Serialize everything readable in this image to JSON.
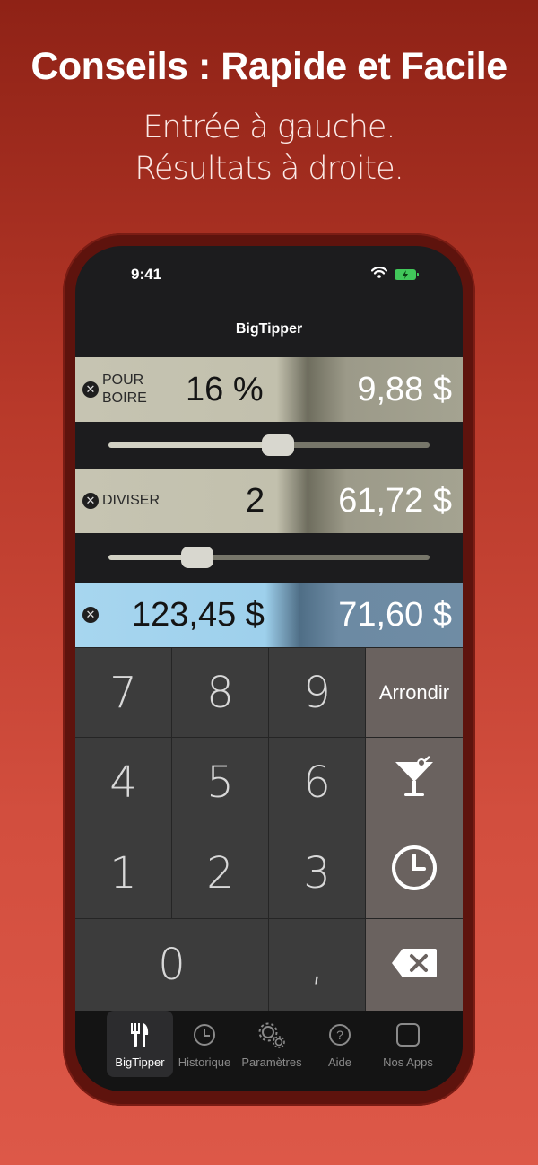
{
  "promo": {
    "headline": "Conseils : Rapide et Facile",
    "subline1": "Entrée à gauche.",
    "subline2": "Résultats à droite."
  },
  "status_bar": {
    "time": "9:41"
  },
  "nav": {
    "title": "BigTipper"
  },
  "tip_row": {
    "label_line1": "POUR",
    "label_line2": "BOIRE",
    "input_value": "16 %",
    "result_value": "9,88 $",
    "slider_value_fraction": 0.53
  },
  "split_row": {
    "label": "DIVISER",
    "input_value": "2",
    "result_value": "61,72 $",
    "slider_value_fraction": 0.28
  },
  "total_row": {
    "input_value": "123,45 $",
    "result_value": "71,60 $"
  },
  "keypad": {
    "keys": {
      "k7": "7",
      "k8": "8",
      "k9": "9",
      "k4": "4",
      "k5": "5",
      "k6": "6",
      "k1": "1",
      "k2": "2",
      "k3": "3",
      "k0": "0",
      "comma": ","
    },
    "round_label": "Arrondir",
    "cocktail_icon": "cocktail-icon",
    "history_icon": "clock-icon",
    "backspace_icon": "backspace-icon"
  },
  "tabbar": {
    "tabs": [
      {
        "label": "BigTipper",
        "icon": "fork-knife-icon",
        "active": true
      },
      {
        "label": "Historique",
        "icon": "clock-icon",
        "active": false
      },
      {
        "label": "Paramètres",
        "icon": "gears-icon",
        "active": false
      },
      {
        "label": "Aide",
        "icon": "question-icon",
        "active": false
      },
      {
        "label": "Nos Apps",
        "icon": "square-icon",
        "active": false
      }
    ]
  },
  "colors": {
    "background_top": "#8f2216",
    "background_bottom": "#dd5848",
    "tip_row_left": "#c6c4b2",
    "total_row_left": "#a7d6ef",
    "keypad_key": "#3c3c3c",
    "function_key": "#6a625f",
    "battery": "#41c75a"
  }
}
